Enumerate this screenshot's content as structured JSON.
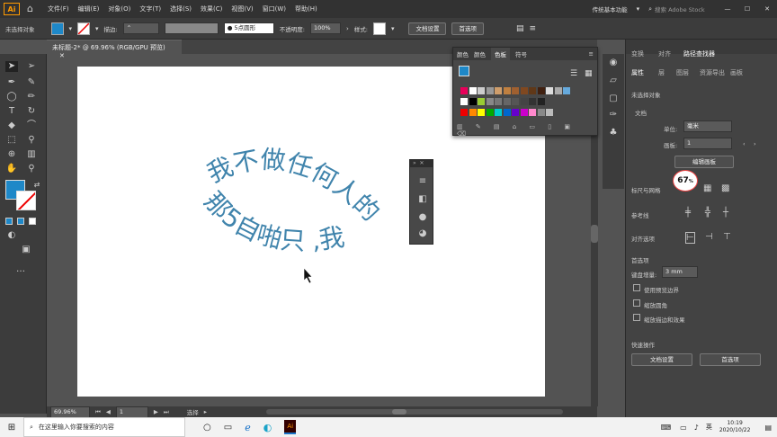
{
  "app": {
    "logo_text": "Ai",
    "menus": [
      "文件(F)",
      "编辑(E)",
      "对象(O)",
      "文字(T)",
      "选择(S)",
      "效果(C)",
      "视图(V)",
      "窗口(W)",
      "帮助(H)"
    ],
    "workspace": "传统基本功能",
    "search_placeholder": "搜索 Adobe Stock"
  },
  "control_bar": {
    "no_selection": "未选择对象",
    "stroke_label": "描边:",
    "brush_label": "● 5点圆形",
    "opacity_label": "不透明度:",
    "opacity_value": "100%",
    "style_label": "样式:",
    "doc_setup": "文档设置",
    "prefs": "首选项"
  },
  "document": {
    "tab_title": "未标题-2* @ 69.96% (RGB/GPU 预览)"
  },
  "artwork": {
    "line1": "我不做任何人的",
    "line2": "那5自啪只 ,我"
  },
  "swatches_panel": {
    "tabs": [
      "颜色",
      "颜色",
      "色板",
      "符号"
    ]
  },
  "properties": {
    "top_tabs": [
      "变换",
      "对齐",
      "路径查找器"
    ],
    "tabs": [
      "属性",
      "层",
      "图层",
      "资源导出",
      "画板"
    ],
    "no_selection": "未选择对象",
    "document_label": "文档",
    "units_label": "单位:",
    "units_value": "毫米",
    "artboard_label": "画板:",
    "artboard_value": "1",
    "edit_artboard": "编辑画板",
    "zoom_badge": "67",
    "ruler_grid": "标尺与网格",
    "guides": "参考线",
    "snap": "对齐选项",
    "prefs_header": "首选项",
    "keyboard_inc_label": "键盘增量:",
    "keyboard_inc_value": "3 mm",
    "opt1": "使用预览边界",
    "opt2": "缩放圆角",
    "opt3": "缩放描边和效果",
    "quick_actions": "快速操作",
    "btn_doc_setup": "文档设置",
    "btn_prefs": "首选项"
  },
  "status": {
    "zoom": "69.96%",
    "page": "1",
    "tool": "选择"
  },
  "taskbar": {
    "search": "在这里输入你要搜索的内容",
    "time": "10:19",
    "date": "2020/10/22"
  },
  "colors": {
    "fill": "#1e88c8",
    "text": "#1f6f9e"
  }
}
